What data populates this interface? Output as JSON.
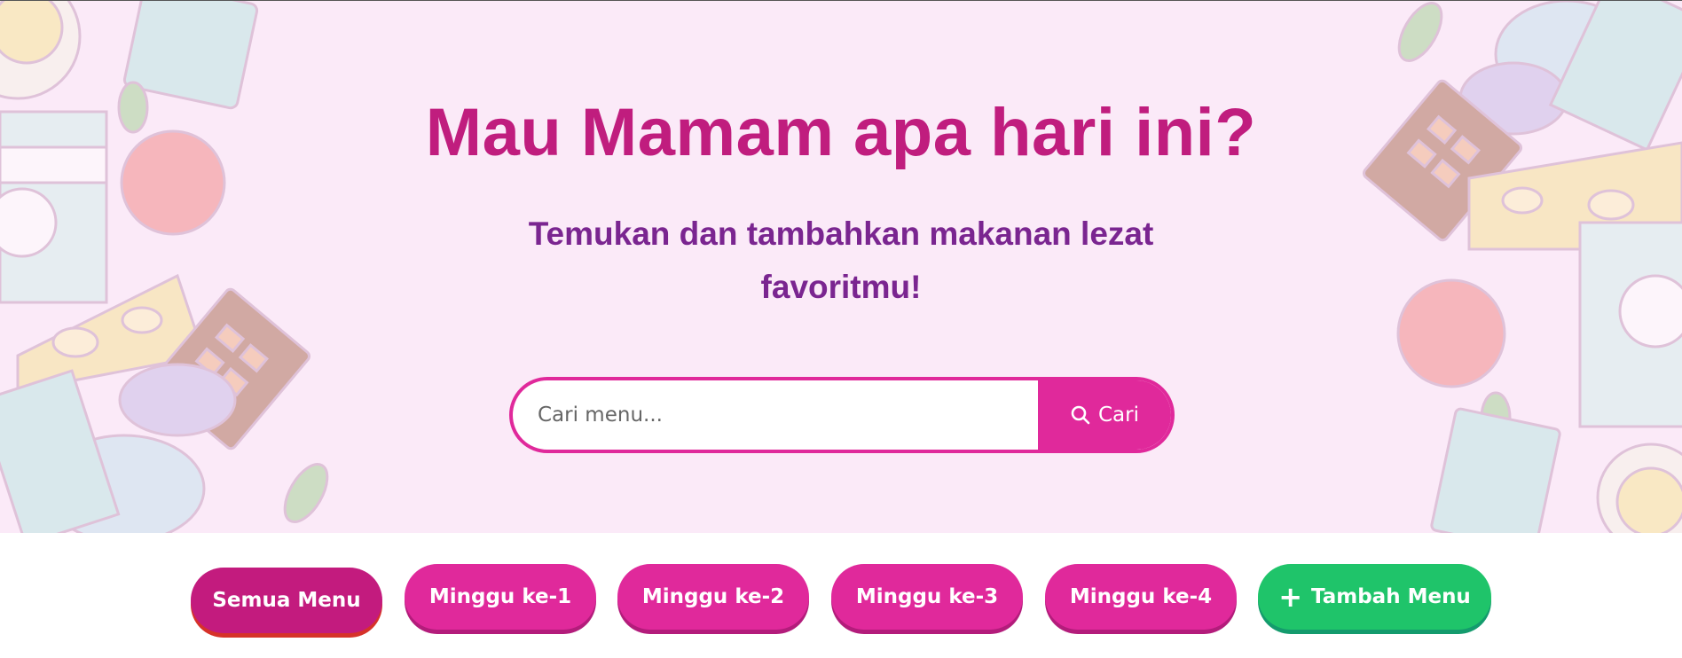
{
  "hero": {
    "title": "Mau Mamam apa hari ini?",
    "subtitle_line1": "Temukan dan tambahkan makanan lezat",
    "subtitle_line2": "favoritmu!"
  },
  "search": {
    "placeholder": "Cari menu...",
    "button_label": "Cari"
  },
  "filters": [
    {
      "label": "Semua Menu",
      "active": true
    },
    {
      "label": "Minggu ke-1",
      "active": false
    },
    {
      "label": "Minggu ke-2",
      "active": false
    },
    {
      "label": "Minggu ke-3",
      "active": false
    },
    {
      "label": "Minggu ke-4",
      "active": false
    }
  ],
  "add_menu": {
    "label": "Tambah Menu",
    "icon": "plus-icon"
  },
  "colors": {
    "primary_pink": "#e0299b",
    "title_pink": "#c01d7e",
    "subtitle_purple": "#7a2590",
    "hero_bg": "#fbeaf8",
    "add_green": "#1fc46a"
  }
}
